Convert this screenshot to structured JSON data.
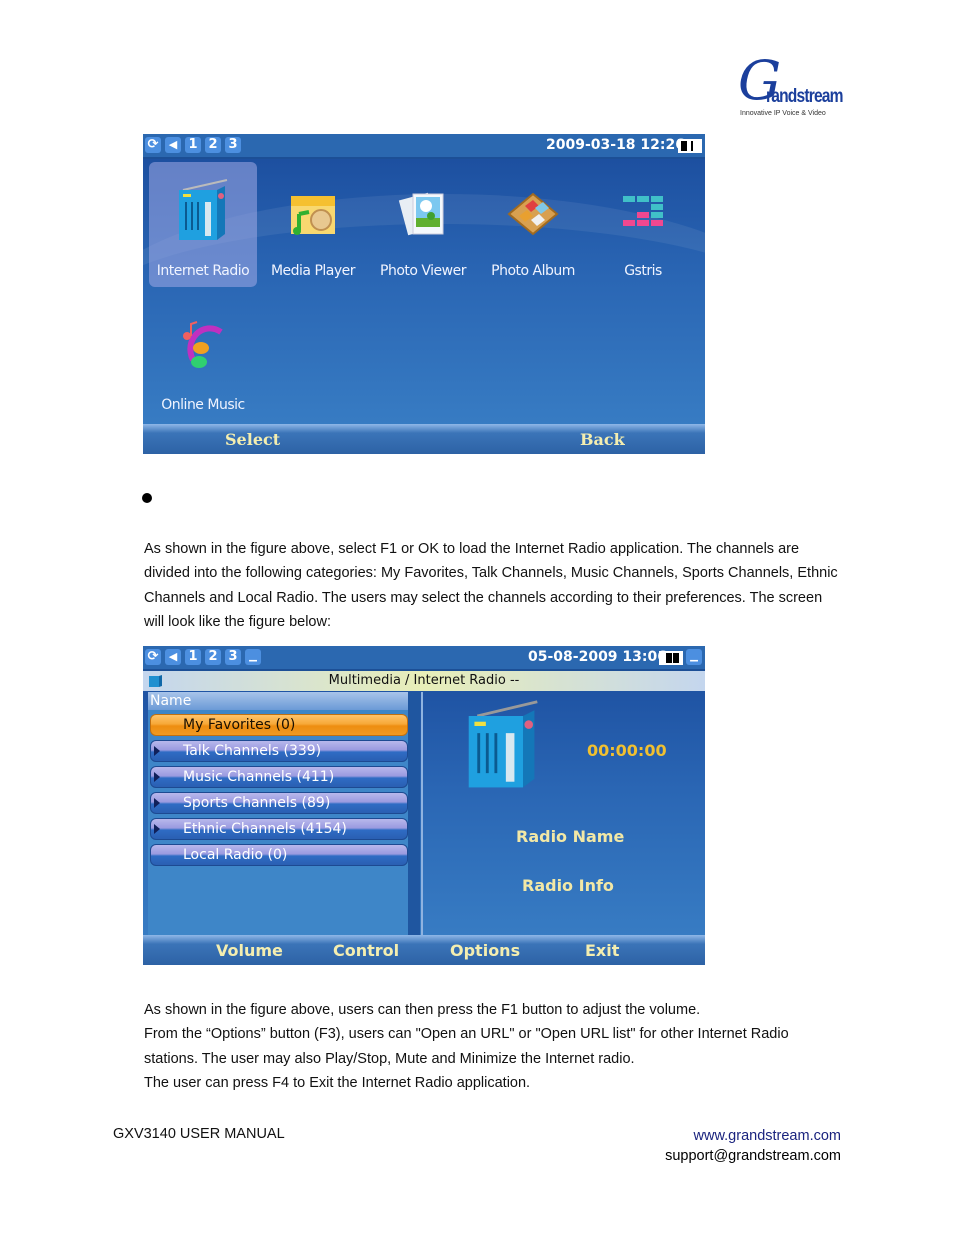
{
  "logo": {
    "mark": "G",
    "wordmark": "randstream",
    "tagline": "Innovative IP Voice & Video"
  },
  "screen1": {
    "status": {
      "icons": [
        "sync-icon",
        "speaker-icon",
        "line-1",
        "line-2",
        "line-3"
      ],
      "line_labels": [
        "1",
        "2",
        "3"
      ],
      "datetime": "2009-03-18 12:26"
    },
    "apps": [
      {
        "label": "Internet Radio",
        "icon": "radio-icon",
        "selected": true
      },
      {
        "label": "Media Player",
        "icon": "media-player-icon",
        "selected": false
      },
      {
        "label": "Photo Viewer",
        "icon": "photo-viewer-icon",
        "selected": false
      },
      {
        "label": "Photo Album",
        "icon": "photo-album-icon",
        "selected": false
      },
      {
        "label": "Gstris",
        "icon": "gstris-icon",
        "selected": false
      },
      {
        "label": "Online Music",
        "icon": "headphones-icon",
        "selected": false
      }
    ],
    "softkeys": {
      "left": "Select",
      "right": "Back"
    }
  },
  "bullet": "●",
  "paragraph1": "As shown in the figure above, select F1 or OK to load the Internet Radio application. The channels are divided into the following categories: My Favorites, Talk Channels, Music Channels, Sports Channels, Ethnic Channels and Local Radio. The users may select the channels according to their preferences. The screen will look like the figure below:",
  "screen2": {
    "status": {
      "line_labels": [
        "1",
        "2",
        "3"
      ],
      "datetime": "05-08-2009 13:06"
    },
    "title": "Multimedia / Internet Radio  --",
    "list_header": "Name",
    "channels": [
      {
        "label": "My Favorites (0)",
        "expandable": false,
        "selected": true
      },
      {
        "label": "Talk Channels (339)",
        "expandable": true,
        "selected": false
      },
      {
        "label": "Music Channels (411)",
        "expandable": true,
        "selected": false
      },
      {
        "label": "Sports Channels (89)",
        "expandable": true,
        "selected": false
      },
      {
        "label": "Ethnic Channels (4154)",
        "expandable": true,
        "selected": false
      },
      {
        "label": "Local Radio (0)",
        "expandable": false,
        "selected": false
      }
    ],
    "timer": "00:00:00",
    "radio_name": "Radio Name",
    "radio_info": "Radio Info",
    "softkeys": [
      "Volume",
      "Control",
      "Options",
      "Exit"
    ]
  },
  "paragraph2": [
    "As shown in the figure above, users can then press the F1 button to adjust the volume.",
    "From the “Options” button (F3), users can \"Open an URL\" or \"Open URL list\" for other Internet Radio stations. The user may also Play/Stop, Mute and Minimize the Internet radio.",
    "The user can press F4 to Exit the Internet Radio application."
  ],
  "footer": {
    "title": "GXV3140 USER MANUAL",
    "website": "www.grandstream.com",
    "email": "support@grandstream.com"
  },
  "colors": {
    "screen_blue": "#2a66b4",
    "softkey_text": "#f4eeb0",
    "selected_orange": "#f7a838",
    "link": "#1a237e"
  }
}
